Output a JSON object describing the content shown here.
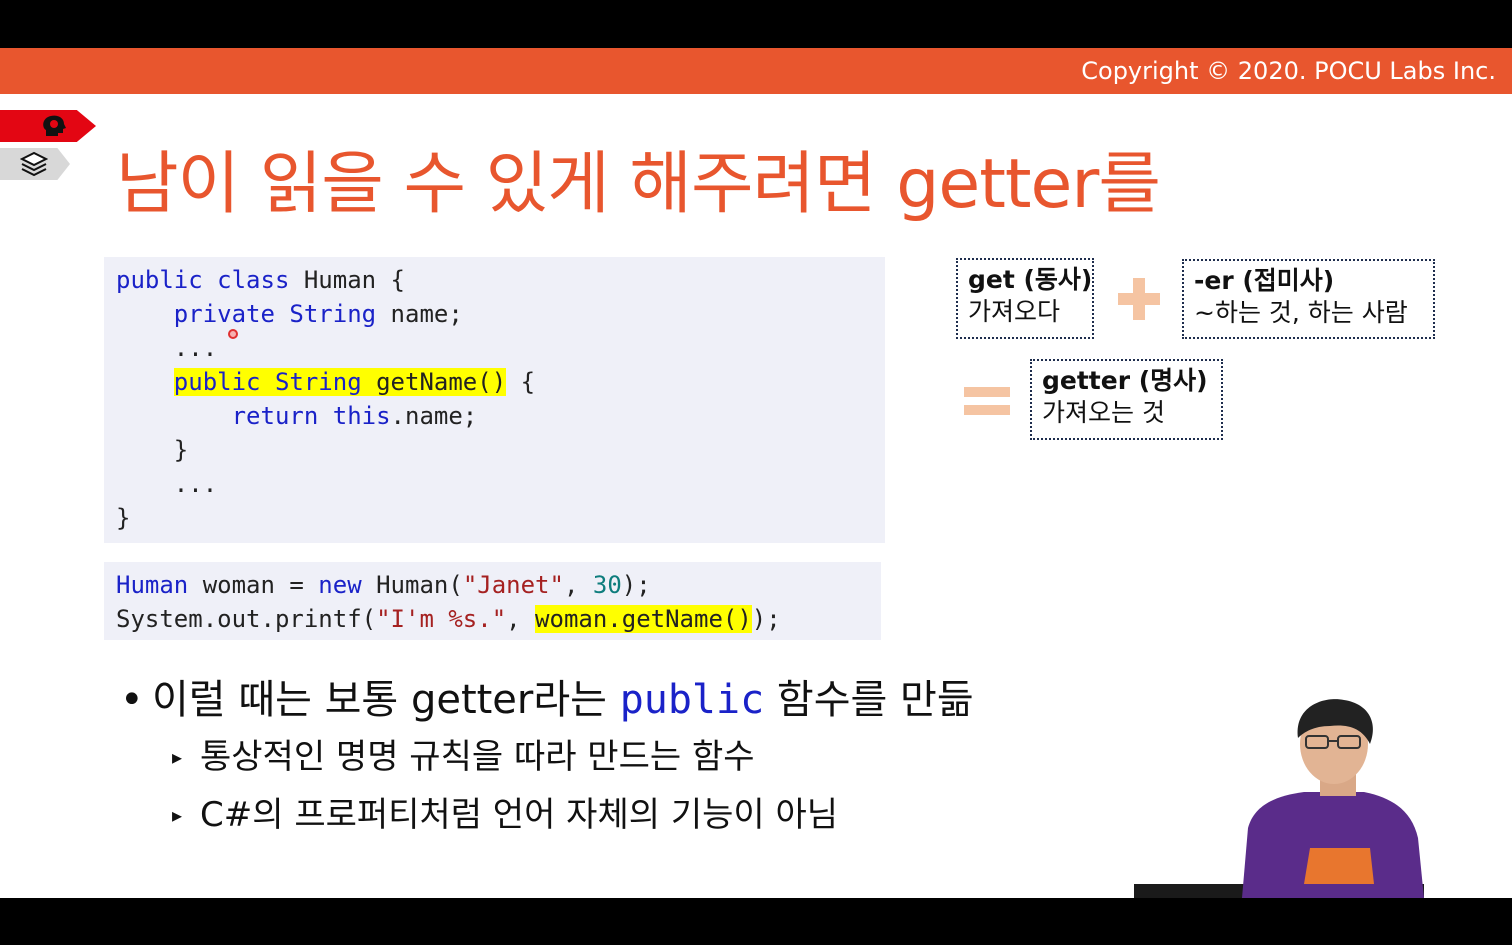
{
  "header": {
    "copyright": "Copyright © 2020. POCU Labs Inc."
  },
  "title": "남이 읽을 수 있게 해주려면 getter를",
  "code_block_1": {
    "lines": [
      [
        "public class Human {"
      ],
      [
        "    private String name;"
      ],
      [
        "    ..."
      ],
      [
        "    public String getName() {"
      ],
      [
        "        return this.name;"
      ],
      [
        "    }"
      ],
      [
        "    ..."
      ],
      [
        "}"
      ]
    ]
  },
  "code_block_2": {
    "line1": "Human woman = new Human(\"Janet\", 30);",
    "line2": "System.out.printf(\"I'm %s.\", woman.getName());"
  },
  "word_boxes": {
    "get": {
      "title": "get (동사)",
      "meaning": "가져오다"
    },
    "er": {
      "title": "-er (접미사)",
      "meaning": "~하는 것, 하는 사람"
    },
    "getter": {
      "title": "getter (명사)",
      "meaning": "가져오는 것"
    }
  },
  "bullets": {
    "main": {
      "pre": "이럴 때는 보통 getter라는 ",
      "keyword": "public",
      "post": " 함수를 만듦"
    },
    "sub": [
      "통상적인 명명 규칙을 따라 만드는 함수",
      "C#의 프로퍼티처럼 언어 자체의 기능이 아님"
    ]
  },
  "colors": {
    "accent": "#e8562e",
    "keyword": "#1a22c8",
    "highlight": "#ffff00"
  },
  "icons": [
    "head-icon",
    "books-icon",
    "plus-icon",
    "equals-icon",
    "bullet-dot-icon",
    "triangle-bullet-icon"
  ]
}
